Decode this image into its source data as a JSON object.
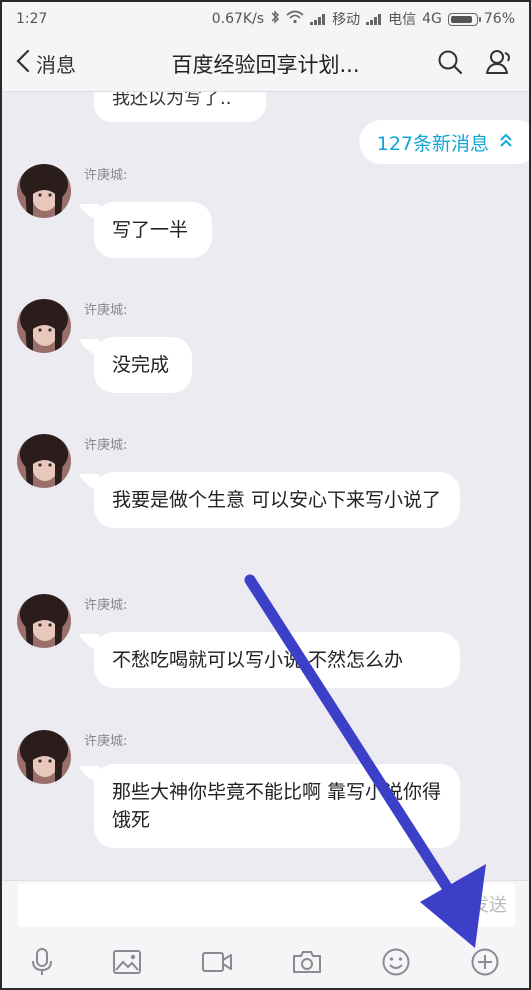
{
  "status_bar": {
    "time": "1:27",
    "speed": "0.67K/s",
    "carrier1": "移动",
    "carrier2": "电信",
    "network": "4G",
    "battery": "76%"
  },
  "header": {
    "back_label": "消息",
    "title": "百度经验回享计划...",
    "icons": [
      "search-icon",
      "profile-icon"
    ]
  },
  "chat": {
    "prev_partial_text": "我还以为写了..",
    "new_messages_label": "127条新消息",
    "messages": [
      {
        "sender": "许庚城:",
        "text": "写了一半"
      },
      {
        "sender": "许庚城:",
        "text": "没完成"
      },
      {
        "sender": "许庚城:",
        "text": "我要是做个生意 可以安心下来写小说了"
      },
      {
        "sender": "许庚城:",
        "text": "不愁吃喝就可以写小说 不然怎么办"
      },
      {
        "sender": "许庚城:",
        "text": "那些大神你毕竟不能比啊 靠写小说你得饿死"
      }
    ]
  },
  "input": {
    "value": "",
    "send_label": "发送"
  },
  "toolbar": {
    "icons": [
      "microphone-icon",
      "image-icon",
      "video-icon",
      "camera-icon",
      "emoji-icon",
      "plus-icon"
    ]
  },
  "colors": {
    "accent": "#12a5d6",
    "annotation_arrow": "#3c3fc8",
    "background": "#ebebf1"
  }
}
